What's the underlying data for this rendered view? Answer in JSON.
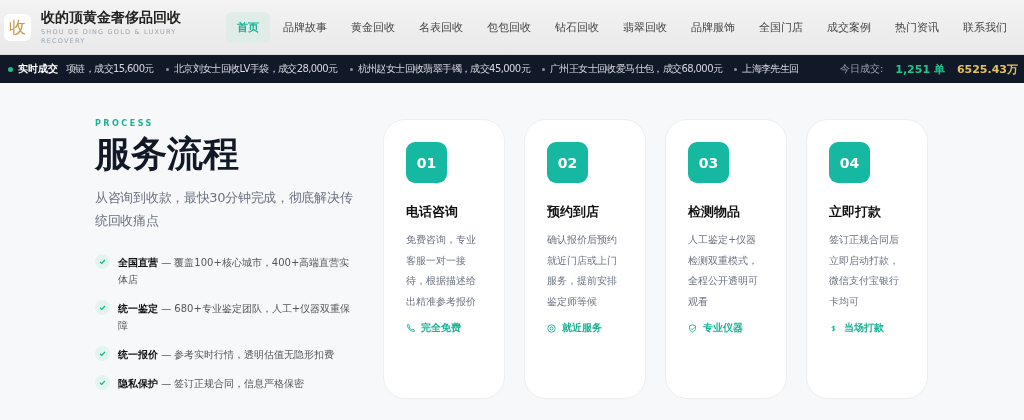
{
  "header": {
    "brand_mark": "收",
    "title": "收的顶黄金奢侈品回收",
    "subtitle": "SHOU DE DING GOLD & LUXURY RECOVERY",
    "nav": [
      {
        "label": "首页",
        "selected": true
      },
      {
        "label": "品牌故事",
        "selected": false
      },
      {
        "label": "黄金回收",
        "selected": false
      },
      {
        "label": "名表回收",
        "selected": false
      },
      {
        "label": "包包回收",
        "selected": false
      },
      {
        "label": "钻石回收",
        "selected": false
      },
      {
        "label": "翡翠回收",
        "selected": false
      },
      {
        "label": "品牌服饰",
        "selected": false
      },
      {
        "label": "全国门店",
        "selected": false
      },
      {
        "label": "成交案例",
        "selected": false
      },
      {
        "label": "热门资讯",
        "selected": false
      },
      {
        "label": "联系我们",
        "selected": false
      }
    ]
  },
  "ticker": {
    "label": "实时成交",
    "items": [
      "项链，成交15,600元",
      "北京刘女士回收LV手袋，成交28,000元",
      "杭州赵女士回收翡翠手镯，成交45,000元",
      "广州王女士回收爱马仕包，成交68,000元",
      "上海李先生回"
    ],
    "stats_label": "今日成交:",
    "orders": "1,251 单",
    "amount": "6525.43万"
  },
  "process": {
    "eyebrow": "PROCESS",
    "title": "服务流程",
    "subtitle": "从咨询到收款，最快30分钟完成，彻底解决传统回收痛点",
    "features": [
      "**全国直营** — 覆盖100+核心城市，400+高端直营实体店",
      "**统一鉴定** — 680+专业鉴定团队，人工+仪器双重保障",
      "**统一报价** — 参考实时行情，透明估值无隐形扣费",
      "**隐私保护** — 签订正规合同，信息严格保密"
    ],
    "steps": [
      {
        "number": "01",
        "title": "电话咨询",
        "text": "免费咨询，专业客服一对一接待，根据描述给出精准参考报价",
        "tag": "完全免费",
        "kind": "phone"
      },
      {
        "number": "02",
        "title": "预约到店",
        "text": "确认报价后预约就近门店或上门服务，提前安排鉴定师等候",
        "tag": "就近服务",
        "kind": "pin"
      },
      {
        "number": "03",
        "title": "检测物品",
        "text": "人工鉴定+仪器检测双重模式，全程公开透明可观看",
        "tag": "专业仪器",
        "kind": "shield"
      },
      {
        "number": "04",
        "title": "立即打款",
        "text": "签订正规合同后立即启动打款，微信支付宝银行卡均可",
        "tag": "当场打款",
        "kind": "dollar"
      }
    ]
  }
}
